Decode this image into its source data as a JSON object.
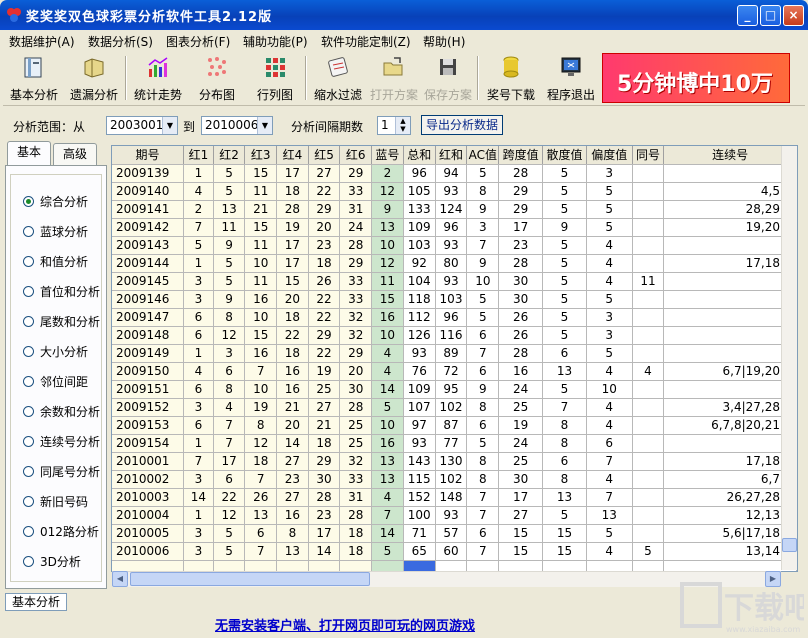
{
  "window": {
    "title": "奖奖奖双色球彩票分析软件工具2.12版",
    "controls": {
      "minimize": "_",
      "maximize": "□",
      "close": "×"
    }
  },
  "menu": [
    "数据维护(A)",
    "数据分析(S)",
    "图表分析(F)",
    "辅助功能(P)",
    "软件功能定制(Z)",
    "帮助(H)"
  ],
  "toolbar": [
    {
      "label": "基本分析",
      "icon": "book-icon",
      "enabled": true
    },
    {
      "label": "遗漏分析",
      "icon": "folder-icon",
      "enabled": true
    },
    {
      "label": "统计走势",
      "icon": "chart-icon",
      "enabled": true
    },
    {
      "label": "分布图",
      "icon": "scatter-icon",
      "enabled": true
    },
    {
      "label": "行列图",
      "icon": "grid-icon",
      "enabled": true
    },
    {
      "label": "缩水过滤",
      "icon": "filter-icon",
      "enabled": true
    },
    {
      "label": "打开方案",
      "icon": "open-folder-icon",
      "enabled": false
    },
    {
      "label": "保存方案",
      "icon": "save-icon",
      "enabled": false
    },
    {
      "label": "奖号下载",
      "icon": "coin-stack-icon",
      "enabled": true
    },
    {
      "label": "程序退出",
      "icon": "monitor-exit-icon",
      "enabled": true
    }
  ],
  "banner": {
    "text": "5分钟博中10万"
  },
  "filter": {
    "range_label": "分析范围：从",
    "from": "2003001",
    "to_label": "到",
    "to": "2010006",
    "interval_label": "分析间隔期数",
    "interval": "1",
    "export_label": "导出分析数据"
  },
  "left_tabs": [
    "基本",
    "高级"
  ],
  "analysis_options": [
    {
      "label": "综合分析",
      "selected": true
    },
    {
      "label": "蓝球分析",
      "selected": false
    },
    {
      "label": "和值分析",
      "selected": false
    },
    {
      "label": "首位和分析",
      "selected": false
    },
    {
      "label": "尾数和分析",
      "selected": false
    },
    {
      "label": "大小分析",
      "selected": false
    },
    {
      "label": "邻位间距",
      "selected": false
    },
    {
      "label": "余数和分析",
      "selected": false
    },
    {
      "label": "连续号分析",
      "selected": false
    },
    {
      "label": "同尾号分析",
      "selected": false
    },
    {
      "label": "新旧号码",
      "selected": false
    },
    {
      "label": "012路分析",
      "selected": false
    },
    {
      "label": "3D分析",
      "selected": false
    }
  ],
  "table": {
    "headers": [
      "期号",
      "红1",
      "红2",
      "红3",
      "红4",
      "红5",
      "红6",
      "蓝号",
      "总和",
      "红和",
      "AC值",
      "跨度值",
      "散度值",
      "偏度值",
      "同号",
      "连续号"
    ],
    "rows": [
      [
        "2009139",
        "1",
        "5",
        "15",
        "17",
        "27",
        "29",
        "2",
        "96",
        "94",
        "5",
        "28",
        "5",
        "3",
        "",
        ""
      ],
      [
        "2009140",
        "4",
        "5",
        "11",
        "18",
        "22",
        "33",
        "12",
        "105",
        "93",
        "8",
        "29",
        "5",
        "5",
        "",
        "4,5"
      ],
      [
        "2009141",
        "2",
        "13",
        "21",
        "28",
        "29",
        "31",
        "9",
        "133",
        "124",
        "9",
        "29",
        "5",
        "5",
        "",
        "28,29"
      ],
      [
        "2009142",
        "7",
        "11",
        "15",
        "19",
        "20",
        "24",
        "13",
        "109",
        "96",
        "3",
        "17",
        "9",
        "5",
        "",
        "19,20"
      ],
      [
        "2009143",
        "5",
        "9",
        "11",
        "17",
        "23",
        "28",
        "10",
        "103",
        "93",
        "7",
        "23",
        "5",
        "4",
        "",
        ""
      ],
      [
        "2009144",
        "1",
        "5",
        "10",
        "17",
        "18",
        "29",
        "12",
        "92",
        "80",
        "9",
        "28",
        "5",
        "4",
        "",
        "17,18"
      ],
      [
        "2009145",
        "3",
        "5",
        "11",
        "15",
        "26",
        "33",
        "11",
        "104",
        "93",
        "10",
        "30",
        "5",
        "4",
        "11",
        ""
      ],
      [
        "2009146",
        "3",
        "9",
        "16",
        "20",
        "22",
        "33",
        "15",
        "118",
        "103",
        "5",
        "30",
        "5",
        "5",
        "",
        ""
      ],
      [
        "2009147",
        "6",
        "8",
        "10",
        "18",
        "22",
        "32",
        "16",
        "112",
        "96",
        "5",
        "26",
        "5",
        "3",
        "",
        ""
      ],
      [
        "2009148",
        "6",
        "12",
        "15",
        "22",
        "29",
        "32",
        "10",
        "126",
        "116",
        "6",
        "26",
        "5",
        "3",
        "",
        ""
      ],
      [
        "2009149",
        "1",
        "3",
        "16",
        "18",
        "22",
        "29",
        "4",
        "93",
        "89",
        "7",
        "28",
        "6",
        "5",
        "",
        ""
      ],
      [
        "2009150",
        "4",
        "6",
        "7",
        "16",
        "19",
        "20",
        "4",
        "76",
        "72",
        "6",
        "16",
        "13",
        "4",
        "4",
        "6,7|19,20"
      ],
      [
        "2009151",
        "6",
        "8",
        "10",
        "16",
        "25",
        "30",
        "14",
        "109",
        "95",
        "9",
        "24",
        "5",
        "10",
        "",
        ""
      ],
      [
        "2009152",
        "3",
        "4",
        "19",
        "21",
        "27",
        "28",
        "5",
        "107",
        "102",
        "8",
        "25",
        "7",
        "4",
        "",
        "3,4|27,28"
      ],
      [
        "2009153",
        "6",
        "7",
        "8",
        "20",
        "21",
        "25",
        "10",
        "97",
        "87",
        "6",
        "19",
        "8",
        "4",
        "",
        "6,7,8|20,21"
      ],
      [
        "2009154",
        "1",
        "7",
        "12",
        "14",
        "18",
        "25",
        "16",
        "93",
        "77",
        "5",
        "24",
        "8",
        "6",
        "",
        ""
      ],
      [
        "2010001",
        "7",
        "17",
        "18",
        "27",
        "29",
        "32",
        "13",
        "143",
        "130",
        "8",
        "25",
        "6",
        "7",
        "",
        "17,18"
      ],
      [
        "2010002",
        "3",
        "6",
        "7",
        "23",
        "30",
        "33",
        "13",
        "115",
        "102",
        "8",
        "30",
        "8",
        "4",
        "",
        "6,7"
      ],
      [
        "2010003",
        "14",
        "22",
        "26",
        "27",
        "28",
        "31",
        "4",
        "152",
        "148",
        "7",
        "17",
        "13",
        "7",
        "",
        "26,27,28"
      ],
      [
        "2010004",
        "1",
        "12",
        "13",
        "16",
        "23",
        "28",
        "7",
        "100",
        "93",
        "7",
        "27",
        "5",
        "13",
        "",
        "12,13"
      ],
      [
        "2010005",
        "3",
        "5",
        "6",
        "8",
        "17",
        "18",
        "14",
        "71",
        "57",
        "6",
        "15",
        "15",
        "5",
        "",
        "5,6|17,18"
      ],
      [
        "2010006",
        "3",
        "5",
        "7",
        "13",
        "14",
        "18",
        "5",
        "65",
        "60",
        "7",
        "15",
        "15",
        "4",
        "5",
        "13,14"
      ]
    ]
  },
  "bottom": {
    "tab_label": "基本分析",
    "link_text": "无需安装客户端、打开网页即可玩的网页游戏",
    "watermark": "下载吧",
    "watermark_url": "www.xiazaiba.com"
  },
  "colors": {
    "title_bar": "#0841b8",
    "blue_ball_cell": "#cde6cd",
    "red_ball_cell": "#fdfbe8",
    "link": "#0000cc",
    "banner": "#ff3a6e"
  }
}
